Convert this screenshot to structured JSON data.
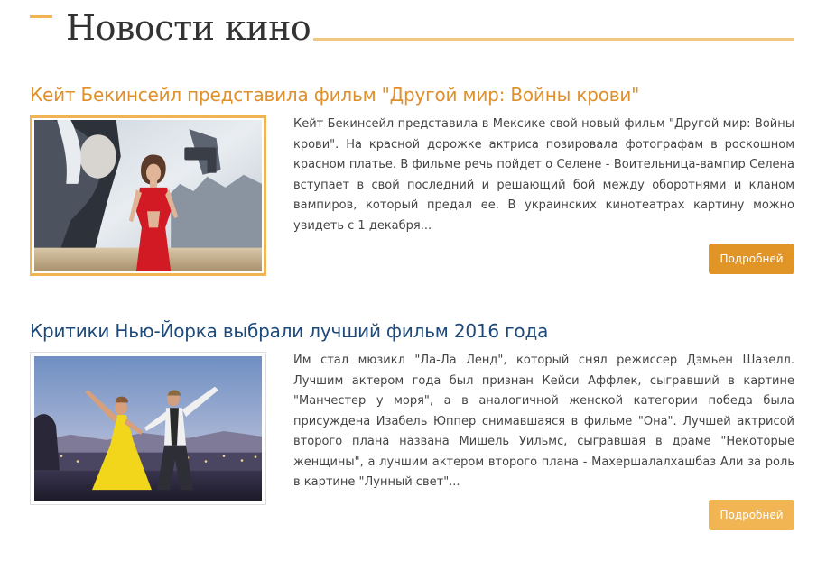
{
  "section": {
    "title": "Новости кино"
  },
  "news": [
    {
      "title": "Кейт Бекинсейл представила фильм \"Другой мир: Войны крови\"",
      "text": "Кейт Бекинсейл представила в Мексике свой новый фильм \"Другой мир: Войны крови\". На красной дорожке актриса позировала фотографам в роскошном красном платье. В фильме речь пойдет о Селене - Воительница-вампир Селена вступает в свой последний и решающий бой между оборотнями и кланом вампиров, который предал ее. В украинских кинотеатрах картину можно увидеть с 1 декабря...",
      "button_label": "Подробней",
      "accent_color": "#e0902a"
    },
    {
      "title": "Критики Нью-Йорка выбрали лучший фильм 2016 года",
      "text": "Им стал мюзикл \"Ла-Ла Ленд\", который снял режиссер Дэмьен Шазелл. Лучшим актером года был признан Кейси Аффлек, сыгравший в картине \"Манчестер у моря\", а в аналогичной женской категории победа была присуждена Изабель Юппер снимавшаяся в фильме \"Она\". Лучшей актрисой второго плана названа Мишель Уильмс, сыгравшая в драме \"Некоторые женщины\", а лучшим актером второго плана - Махершалалхашбаз Али за роль в картине \"Лунный свет\"...",
      "button_label": "Подробней",
      "accent_color": "#1e4a7a"
    }
  ]
}
